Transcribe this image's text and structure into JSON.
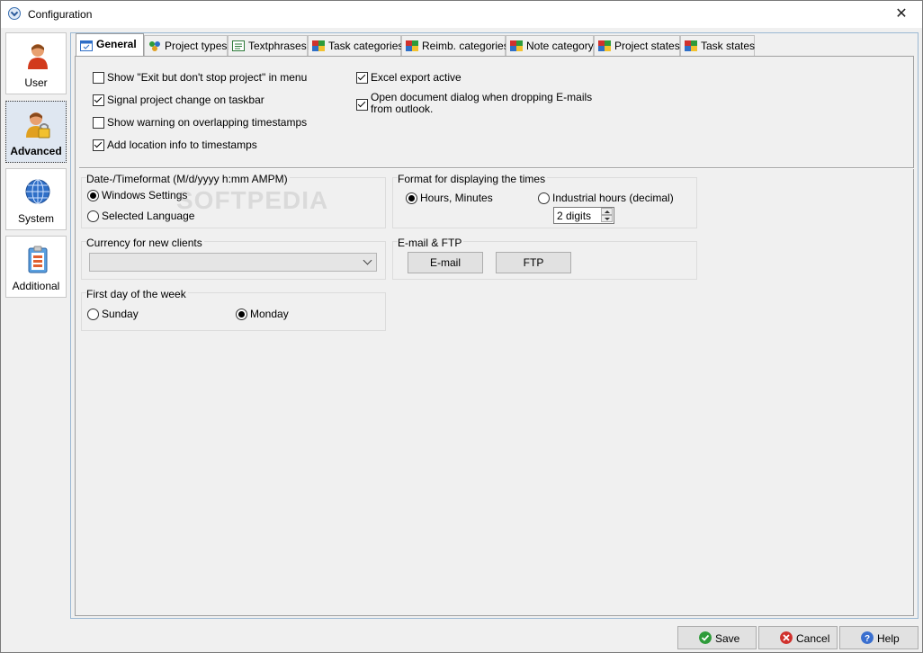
{
  "window": {
    "title": "Configuration",
    "close_glyph": "✕"
  },
  "sidebar": {
    "items": [
      {
        "label": "User",
        "icon": "user-icon"
      },
      {
        "label": "Advanced",
        "icon": "user-lock-icon",
        "active": true
      },
      {
        "label": "System",
        "icon": "globe-icon"
      },
      {
        "label": "Additional",
        "icon": "clipboard-icon"
      }
    ]
  },
  "tabs": [
    {
      "label": "General",
      "active": true
    },
    {
      "label": "Project types"
    },
    {
      "label": "Textphrases"
    },
    {
      "label": "Task categories"
    },
    {
      "label": "Reimb. categories"
    },
    {
      "label": "Note category"
    },
    {
      "label": "Project states"
    },
    {
      "label": "Task states"
    }
  ],
  "general": {
    "checkboxes_left": [
      {
        "label": "Show \"Exit but don't stop project\" in menu",
        "checked": false
      },
      {
        "label": "Signal project change on taskbar",
        "checked": true
      },
      {
        "label": "Show warning on overlapping timestamps",
        "checked": false
      },
      {
        "label": "Add location info to timestamps",
        "checked": true
      }
    ],
    "checkboxes_right": [
      {
        "label": "Excel export active",
        "checked": true
      },
      {
        "label": "Open document dialog when dropping E-mails from outlook.",
        "checked": true
      }
    ],
    "date_format": {
      "title": "Date-/Timeformat (M/d/yyyy h:mm AMPM)",
      "options": [
        "Windows Settings",
        "Selected Language"
      ],
      "selected": "Windows Settings"
    },
    "time_display": {
      "title": "Format for displaying the times",
      "options": [
        "Hours, Minutes",
        "Industrial hours (decimal)"
      ],
      "selected": "Hours, Minutes",
      "digits_value": "2 digits"
    },
    "currency": {
      "title": "Currency for new clients",
      "value": ""
    },
    "email_ftp": {
      "title": "E-mail & FTP",
      "email_label": "E-mail",
      "ftp_label": "FTP"
    },
    "first_day": {
      "title": "First day of the week",
      "options": [
        "Sunday",
        "Monday"
      ],
      "selected": "Monday"
    },
    "watermark": "SOFTPEDIA"
  },
  "footer": {
    "save_label": "Save",
    "cancel_label": "Cancel",
    "help_label": "Help"
  },
  "colors": {
    "accent": "#3c7fb1",
    "save": "#2e9b3a",
    "cancel": "#d0312d",
    "help": "#3a6fcf"
  }
}
